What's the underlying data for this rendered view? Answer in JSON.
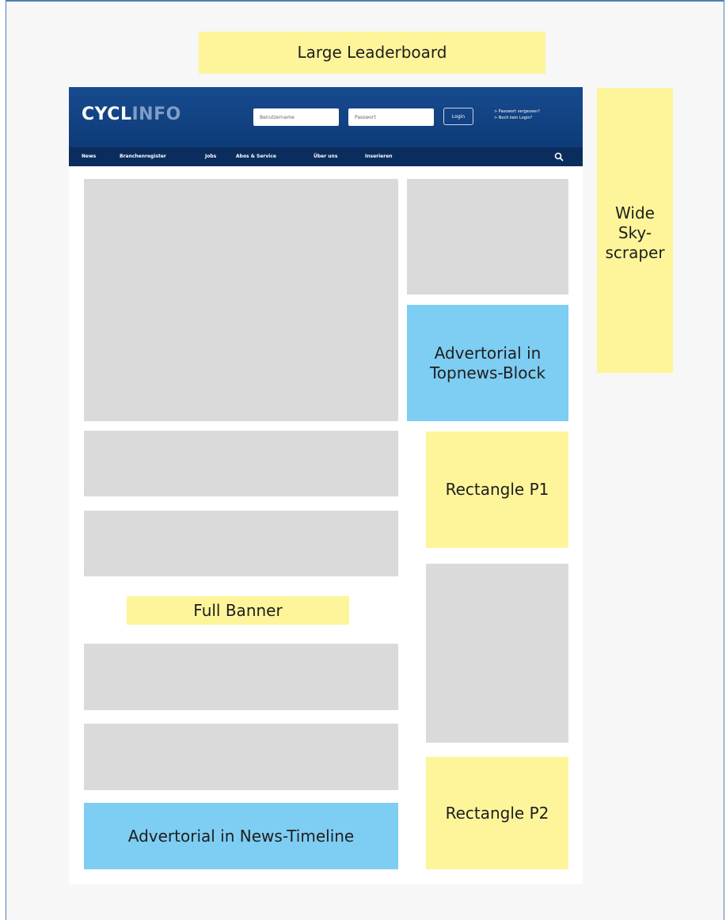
{
  "ad_slots": {
    "large_leaderboard": "Large Leaderboard",
    "wide_skyscraper": "Wide\nSky-\nscraper",
    "advertorial_topnews": "Advertorial in\nTopnews-Block",
    "rectangle_p1": "Rectangle P1",
    "full_banner": "Full Banner",
    "rectangle_p2": "Rectangle P2",
    "advertorial_timeline": "Advertorial in News-Timeline"
  },
  "header": {
    "logo_part1": "CYCL",
    "logo_part2": "INFO",
    "username_placeholder": "Benutzername",
    "password_placeholder": "Passwort",
    "login_label": "Login",
    "forgot_password": "> Passwort vergessen?",
    "no_login": "> Noch kein Login?",
    "nav": [
      "News",
      "Branchenregister",
      "Jobs",
      "Abos & Service",
      "Über uns",
      "Inserieren"
    ]
  },
  "colors": {
    "ad_yellow": "#fef59a",
    "advertorial_blue": "#7ecdf2",
    "content_gray": "#d9dad9",
    "header_blue": "#0f3d7a",
    "frame_border": "#4f7eb3"
  }
}
